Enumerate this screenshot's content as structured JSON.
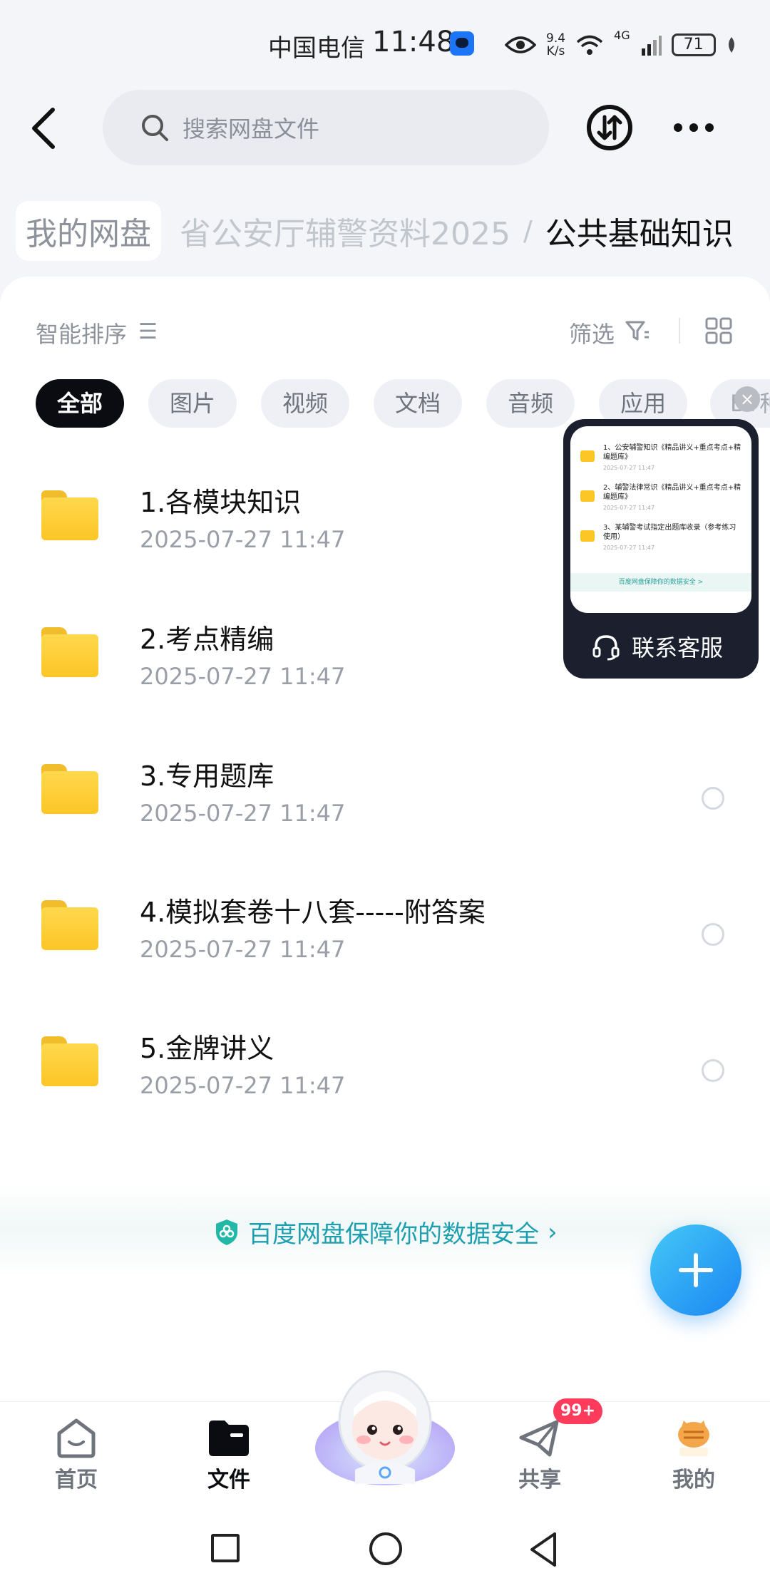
{
  "status_bar": {
    "carrier": "中国电信",
    "time": "11:48",
    "speed_value": "9.4",
    "speed_unit": "K/s",
    "network": "4G",
    "battery": "71"
  },
  "search": {
    "placeholder": "搜索网盘文件"
  },
  "breadcrumb": {
    "root": "我的网盘",
    "middle": "省公安厅辅警资料2025",
    "separator": "/",
    "current": "公共基础知识"
  },
  "toolbar": {
    "sort_label": "智能排序",
    "filter_label": "筛选"
  },
  "filter_chips": [
    "全部",
    "图片",
    "视频",
    "文档",
    "音频",
    "应用"
  ],
  "filter_chip_more": "BT种",
  "files": [
    {
      "name": "1.各模块知识",
      "date": "2025-07-27  11:47"
    },
    {
      "name": "2.考点精编",
      "date": "2025-07-27  11:47"
    },
    {
      "name": "3.专用题库",
      "date": "2025-07-27  11:47"
    },
    {
      "name": "4.模拟套卷十八套-----附答案",
      "date": "2025-07-27  11:47"
    },
    {
      "name": "5.金牌讲义",
      "date": "2025-07-27  11:47"
    }
  ],
  "service_card": {
    "label": "联系客服",
    "preview_items": [
      {
        "name": "1、公安辅警知识《精品讲义+重点考点+精编题库》",
        "meta": "2025-07-27 11:47"
      },
      {
        "name": "2、辅警法律常识《精品讲义+重点考点+精编题库》",
        "meta": "2025-07-27 11:47"
      },
      {
        "name": "3、某辅警考试指定出题库收录（参考练习使用）",
        "meta": "2025-07-27 11:47"
      }
    ],
    "preview_footer": "百度网盘保障你的数据安全 >"
  },
  "security_notice": {
    "text": "百度网盘保障你的数据安全"
  },
  "bottom_nav": {
    "home": "首页",
    "files": "文件",
    "share": "共享",
    "share_badge": "99+",
    "me": "我的"
  },
  "colors": {
    "accent": "#1a86f2",
    "security_teal": "#1e9fb0",
    "folder_yellow": "#fcc626",
    "badge_red": "#ff3b5c"
  },
  "icons": [
    "back-icon",
    "search-icon",
    "transfer-icon",
    "more-icon",
    "sort-icon",
    "filter-icon",
    "grid-view-icon",
    "folder-icon",
    "headset-icon",
    "shield-icon",
    "plus-icon",
    "home-icon",
    "files-icon",
    "share-icon",
    "avatar-icon",
    "mascot-icon"
  ]
}
